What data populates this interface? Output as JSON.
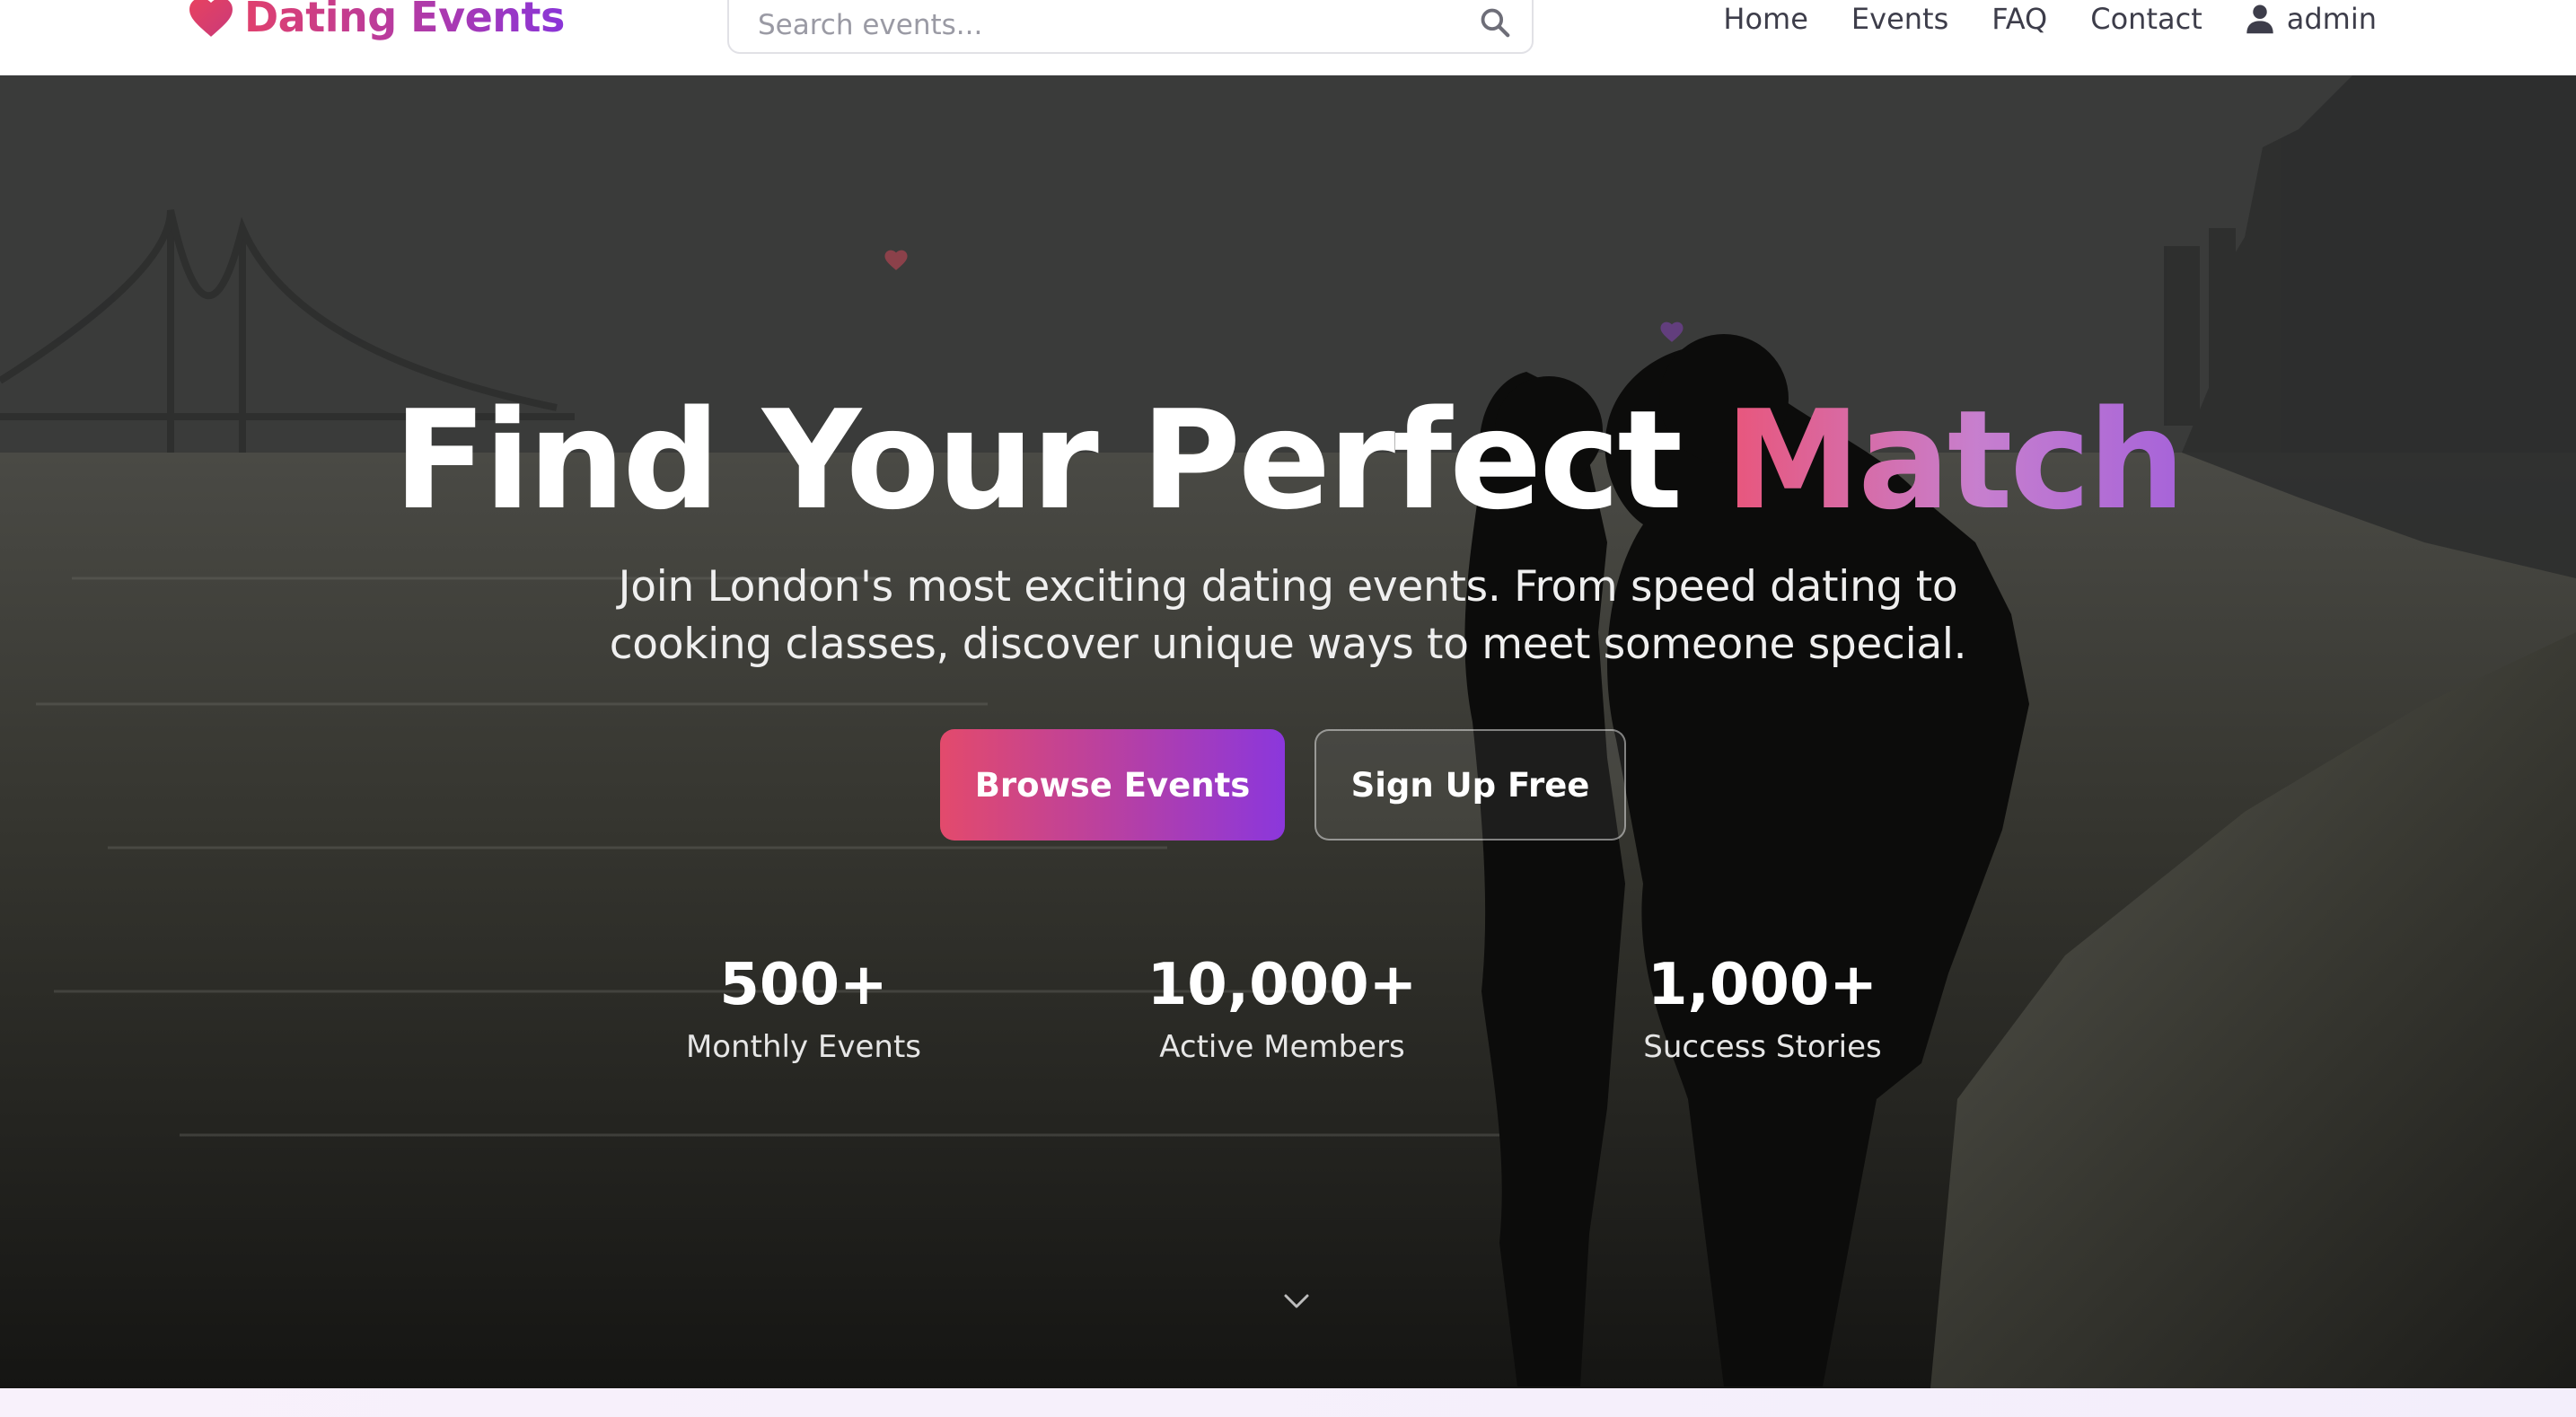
{
  "brand": {
    "name": "Dating Events",
    "icon": "heart-icon"
  },
  "search": {
    "placeholder": "Search events...",
    "value": "",
    "icon": "search-icon"
  },
  "nav": {
    "links": [
      "Home",
      "Events",
      "FAQ",
      "Contact"
    ],
    "user": {
      "label": "admin",
      "icon": "user-icon"
    }
  },
  "hero": {
    "title_main": "Find Your Perfect ",
    "title_accent": "Match",
    "subtitle": "Join London's most exciting dating events. From speed dating to cooking classes, discover unique ways to meet someone special.",
    "primary_button": "Browse Events",
    "secondary_button": "Sign Up Free",
    "stats": [
      {
        "value": "500+",
        "label": "Monthly Events"
      },
      {
        "value": "10,000+",
        "label": "Active Members"
      },
      {
        "value": "1,000+",
        "label": "Success Stories"
      }
    ],
    "scroll_icon": "chevron-down-icon"
  },
  "colors": {
    "brand_gradient_start": "#e0406d",
    "brand_gradient_end": "#8a35d8",
    "accent_pink": "#e9557a",
    "accent_purple": "#a663d9",
    "nav_text": "#3d3d4a"
  }
}
